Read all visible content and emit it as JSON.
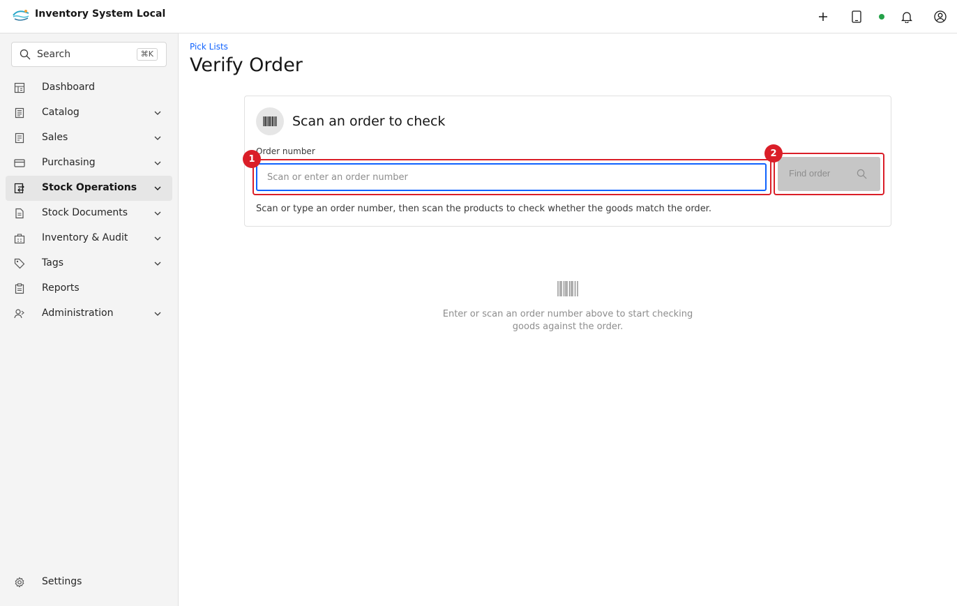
{
  "app": {
    "title": "Inventory System Local"
  },
  "header": {
    "actions": [
      "plus-icon",
      "tablet-icon",
      "status-dot",
      "bell-icon",
      "user-icon"
    ],
    "status_color": "#24a148"
  },
  "sidebar": {
    "search": {
      "label": "Search",
      "shortcut": "⌘K"
    },
    "items": [
      {
        "label": "Dashboard",
        "icon": "dashboard-icon",
        "expandable": false,
        "active": false
      },
      {
        "label": "Catalog",
        "icon": "catalog-icon",
        "expandable": true,
        "active": false
      },
      {
        "label": "Sales",
        "icon": "sales-icon",
        "expandable": true,
        "active": false
      },
      {
        "label": "Purchasing",
        "icon": "credit-card-icon",
        "expandable": true,
        "active": false
      },
      {
        "label": "Stock Operations",
        "icon": "stock-operations-icon",
        "expandable": true,
        "active": true
      },
      {
        "label": "Stock Documents",
        "icon": "document-icon",
        "expandable": true,
        "active": false
      },
      {
        "label": "Inventory & Audit",
        "icon": "inventory-icon",
        "expandable": true,
        "active": false
      },
      {
        "label": "Tags",
        "icon": "tag-icon",
        "expandable": true,
        "active": false
      },
      {
        "label": "Reports",
        "icon": "report-icon",
        "expandable": false,
        "active": false
      },
      {
        "label": "Administration",
        "icon": "user-admin-icon",
        "expandable": true,
        "active": false
      }
    ],
    "settings_label": "Settings"
  },
  "page": {
    "breadcrumb": "Pick Lists",
    "title": "Verify Order"
  },
  "card": {
    "title": "Scan an order to check",
    "field_label": "Order number",
    "input_placeholder": "Scan or enter an order number",
    "input_value": "",
    "button_label": "Find order",
    "helper_text": "Scan or type an order number, then scan the products to check whether the goods match the order.",
    "annotations": [
      "1",
      "2"
    ],
    "annotation_color": "#da1e28"
  },
  "empty_state": {
    "icon": "barcode-icon",
    "text": "Enter or scan an order number above to start checking goods against the order."
  }
}
